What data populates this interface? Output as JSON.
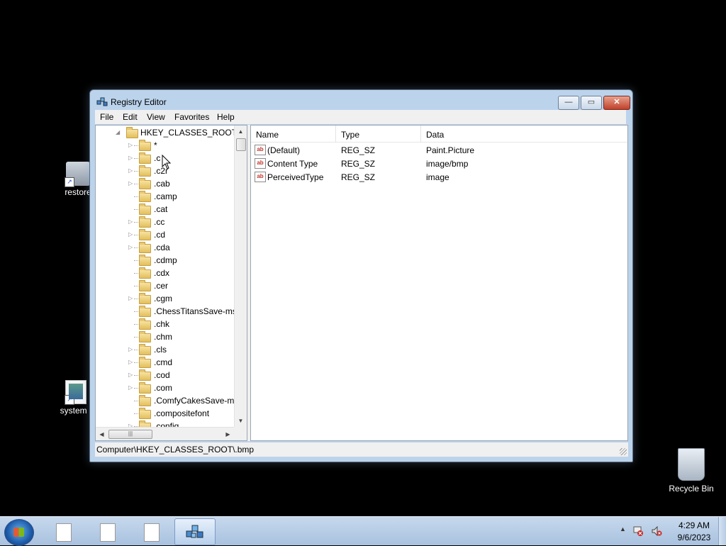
{
  "desktop": {
    "icons": [
      {
        "label": "restore"
      },
      {
        "label": "system t"
      },
      {
        "label": "Recycle Bin"
      }
    ]
  },
  "window": {
    "title": "Registry Editor",
    "menu": [
      "File",
      "Edit",
      "View",
      "Favorites",
      "Help"
    ],
    "tree": {
      "root": "HKEY_CLASSES_ROOT",
      "items": [
        {
          "label": "*",
          "has_children": true
        },
        {
          "label": ".c",
          "has_children": true
        },
        {
          "label": ".c2r",
          "has_children": true
        },
        {
          "label": ".cab",
          "has_children": true
        },
        {
          "label": ".camp",
          "has_children": false
        },
        {
          "label": ".cat",
          "has_children": false
        },
        {
          "label": ".cc",
          "has_children": true
        },
        {
          "label": ".cd",
          "has_children": true
        },
        {
          "label": ".cda",
          "has_children": true
        },
        {
          "label": ".cdmp",
          "has_children": false
        },
        {
          "label": ".cdx",
          "has_children": false
        },
        {
          "label": ".cer",
          "has_children": false
        },
        {
          "label": ".cgm",
          "has_children": true
        },
        {
          "label": ".ChessTitansSave-ms",
          "has_children": false
        },
        {
          "label": ".chk",
          "has_children": false
        },
        {
          "label": ".chm",
          "has_children": false
        },
        {
          "label": ".cls",
          "has_children": true
        },
        {
          "label": ".cmd",
          "has_children": true
        },
        {
          "label": ".cod",
          "has_children": true
        },
        {
          "label": ".com",
          "has_children": true
        },
        {
          "label": ".ComfyCakesSave-ms",
          "has_children": false
        },
        {
          "label": ".compositefont",
          "has_children": false
        },
        {
          "label": ".config",
          "has_children": true
        }
      ]
    },
    "values": {
      "columns": [
        "Name",
        "Type",
        "Data"
      ],
      "rows": [
        {
          "name": "(Default)",
          "type": "REG_SZ",
          "data": "Paint.Picture"
        },
        {
          "name": "Content Type",
          "type": "REG_SZ",
          "data": "image/bmp"
        },
        {
          "name": "PerceivedType",
          "type": "REG_SZ",
          "data": "image"
        }
      ]
    },
    "status": "Computer\\HKEY_CLASSES_ROOT\\.bmp",
    "controls": {
      "minimize": "—",
      "maximize": "▭",
      "close": "✕"
    }
  },
  "taskbar": {
    "time": "4:29 AM",
    "date": "9/6/2023"
  },
  "colors": {
    "desktop": "#000000",
    "window_frame": "#bcd3ec",
    "close_button": "#c0402a",
    "taskbar": "#b8cde6"
  }
}
